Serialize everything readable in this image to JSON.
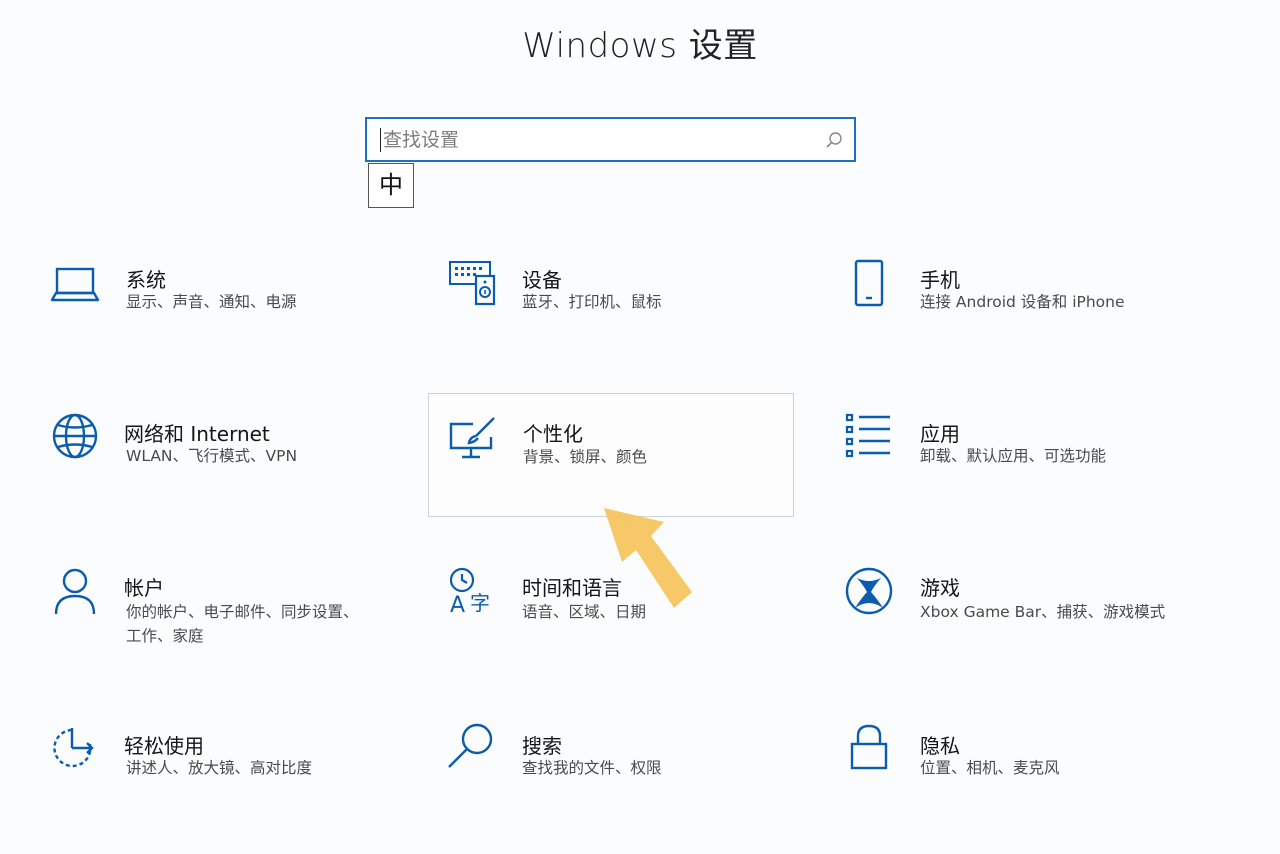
{
  "header": {
    "title": "Windows 设置"
  },
  "search": {
    "placeholder": "查找设置",
    "ime_indicator": "中"
  },
  "colors": {
    "accent": "#1f6fbf",
    "icon": "#0b5cad",
    "arrow": "#f5c35a"
  },
  "tiles": [
    {
      "id": "system",
      "icon": "laptop-icon",
      "title": "系统",
      "desc": "显示、声音、通知、电源"
    },
    {
      "id": "devices",
      "icon": "devices-icon",
      "title": "设备",
      "desc": "蓝牙、打印机、鼠标"
    },
    {
      "id": "phone",
      "icon": "phone-icon",
      "title": "手机",
      "desc": "连接 Android 设备和 iPhone"
    },
    {
      "id": "network",
      "icon": "globe-icon",
      "title": "网络和 Internet",
      "desc": "WLAN、飞行模式、VPN"
    },
    {
      "id": "personalization",
      "icon": "paintbrush-monitor-icon",
      "title": "个性化",
      "desc": "背景、锁屏、颜色",
      "selected": true
    },
    {
      "id": "apps",
      "icon": "app-list-icon",
      "title": "应用",
      "desc": "卸载、默认应用、可选功能"
    },
    {
      "id": "accounts",
      "icon": "person-icon",
      "title": "帐户",
      "desc": "你的帐户、电子邮件、同步设置、工作、家庭"
    },
    {
      "id": "time-language",
      "icon": "time-language-icon",
      "title": "时间和语言",
      "desc": "语音、区域、日期"
    },
    {
      "id": "gaming",
      "icon": "xbox-icon",
      "title": "游戏",
      "desc": "Xbox Game Bar、捕获、游戏模式"
    },
    {
      "id": "ease-of-access",
      "icon": "ease-of-access-icon",
      "title": "轻松使用",
      "desc": "讲述人、放大镜、高对比度"
    },
    {
      "id": "search",
      "icon": "magnifier-icon",
      "title": "搜索",
      "desc": "查找我的文件、权限"
    },
    {
      "id": "privacy",
      "icon": "lock-icon",
      "title": "隐私",
      "desc": "位置、相机、麦克风"
    }
  ]
}
